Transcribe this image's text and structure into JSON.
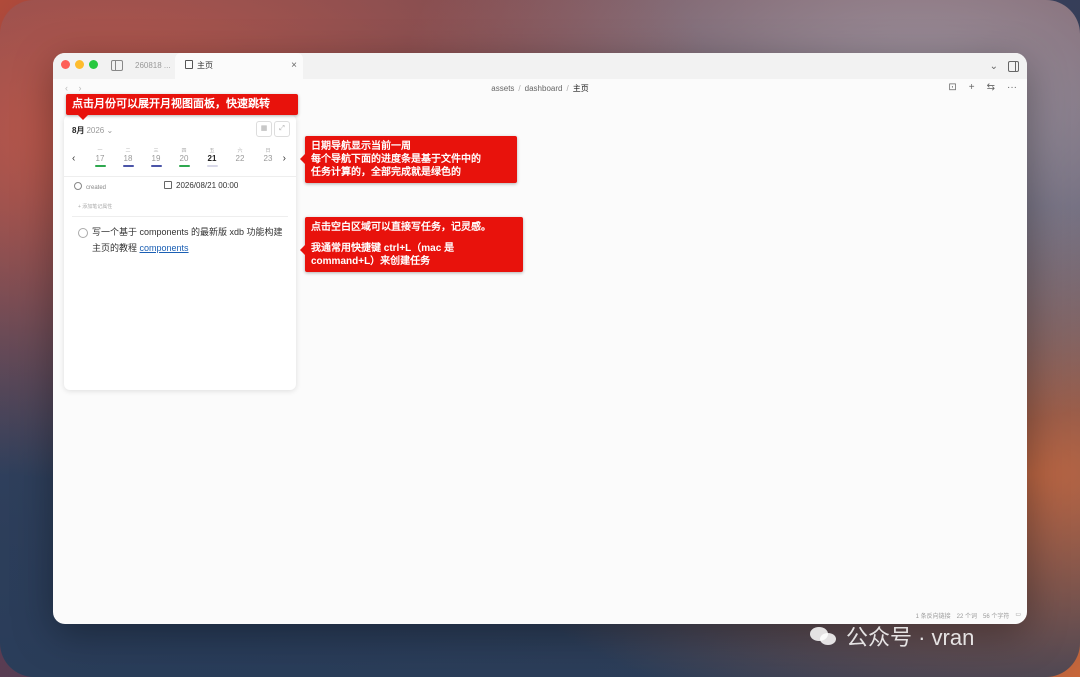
{
  "window": {
    "tabs": [
      {
        "label": "260818 ..."
      },
      {
        "label": "主页"
      }
    ],
    "tab_close": "×",
    "titlebar_icons": {
      "chevron": "⌄"
    }
  },
  "breadcrumb": {
    "items": [
      "assets",
      "dashboard",
      "主页"
    ],
    "separator": "/"
  },
  "toolbar": {
    "lock": "⊡",
    "add": "+",
    "settings": "⇆",
    "more": "···"
  },
  "calendar": {
    "month": "8月",
    "year": "2026",
    "dropdown": "⌄",
    "prev": "‹",
    "next": "›",
    "days": [
      {
        "name": "一",
        "num": "17",
        "bar": "#2fa84f"
      },
      {
        "name": "二",
        "num": "18",
        "bar": "#4b55a8"
      },
      {
        "name": "三",
        "num": "19",
        "bar": "#4b55a8"
      },
      {
        "name": "四",
        "num": "20",
        "bar": "#2fa84f"
      },
      {
        "name": "五",
        "num": "21",
        "bar": "#d8d8e8"
      },
      {
        "name": "六",
        "num": "22",
        "bar": ""
      },
      {
        "name": "日",
        "num": "23",
        "bar": ""
      }
    ]
  },
  "properties": {
    "created_label": "created",
    "created_value": "2026/08/21 00:00",
    "add_property": "+ 添加笔记属性"
  },
  "task": {
    "text": "写一个基于 components 的最新版 xdb 功能构建主页的教程",
    "link": "components"
  },
  "status": {
    "backlinks": "1 条反向链接",
    "words": "22 个词",
    "chars": "56 个字符"
  },
  "callouts": {
    "c1": "点击月份可以展开月视图面板，快速跳转",
    "c2": [
      "日期导航显示当前一周",
      "每个导航下面的进度条是基于文件中的",
      "任务计算的，全部完成就是绿色的"
    ],
    "c3": [
      "点击空白区域可以直接写任务，记灵感。",
      "我通常用快捷键 ctrl+L（mac 是",
      "command+L）来创建任务"
    ]
  },
  "watermark": "公众号 · vran",
  "colors": {
    "callout": "#e8120c",
    "done": "#2fa84f",
    "partial": "#4b55a8"
  }
}
